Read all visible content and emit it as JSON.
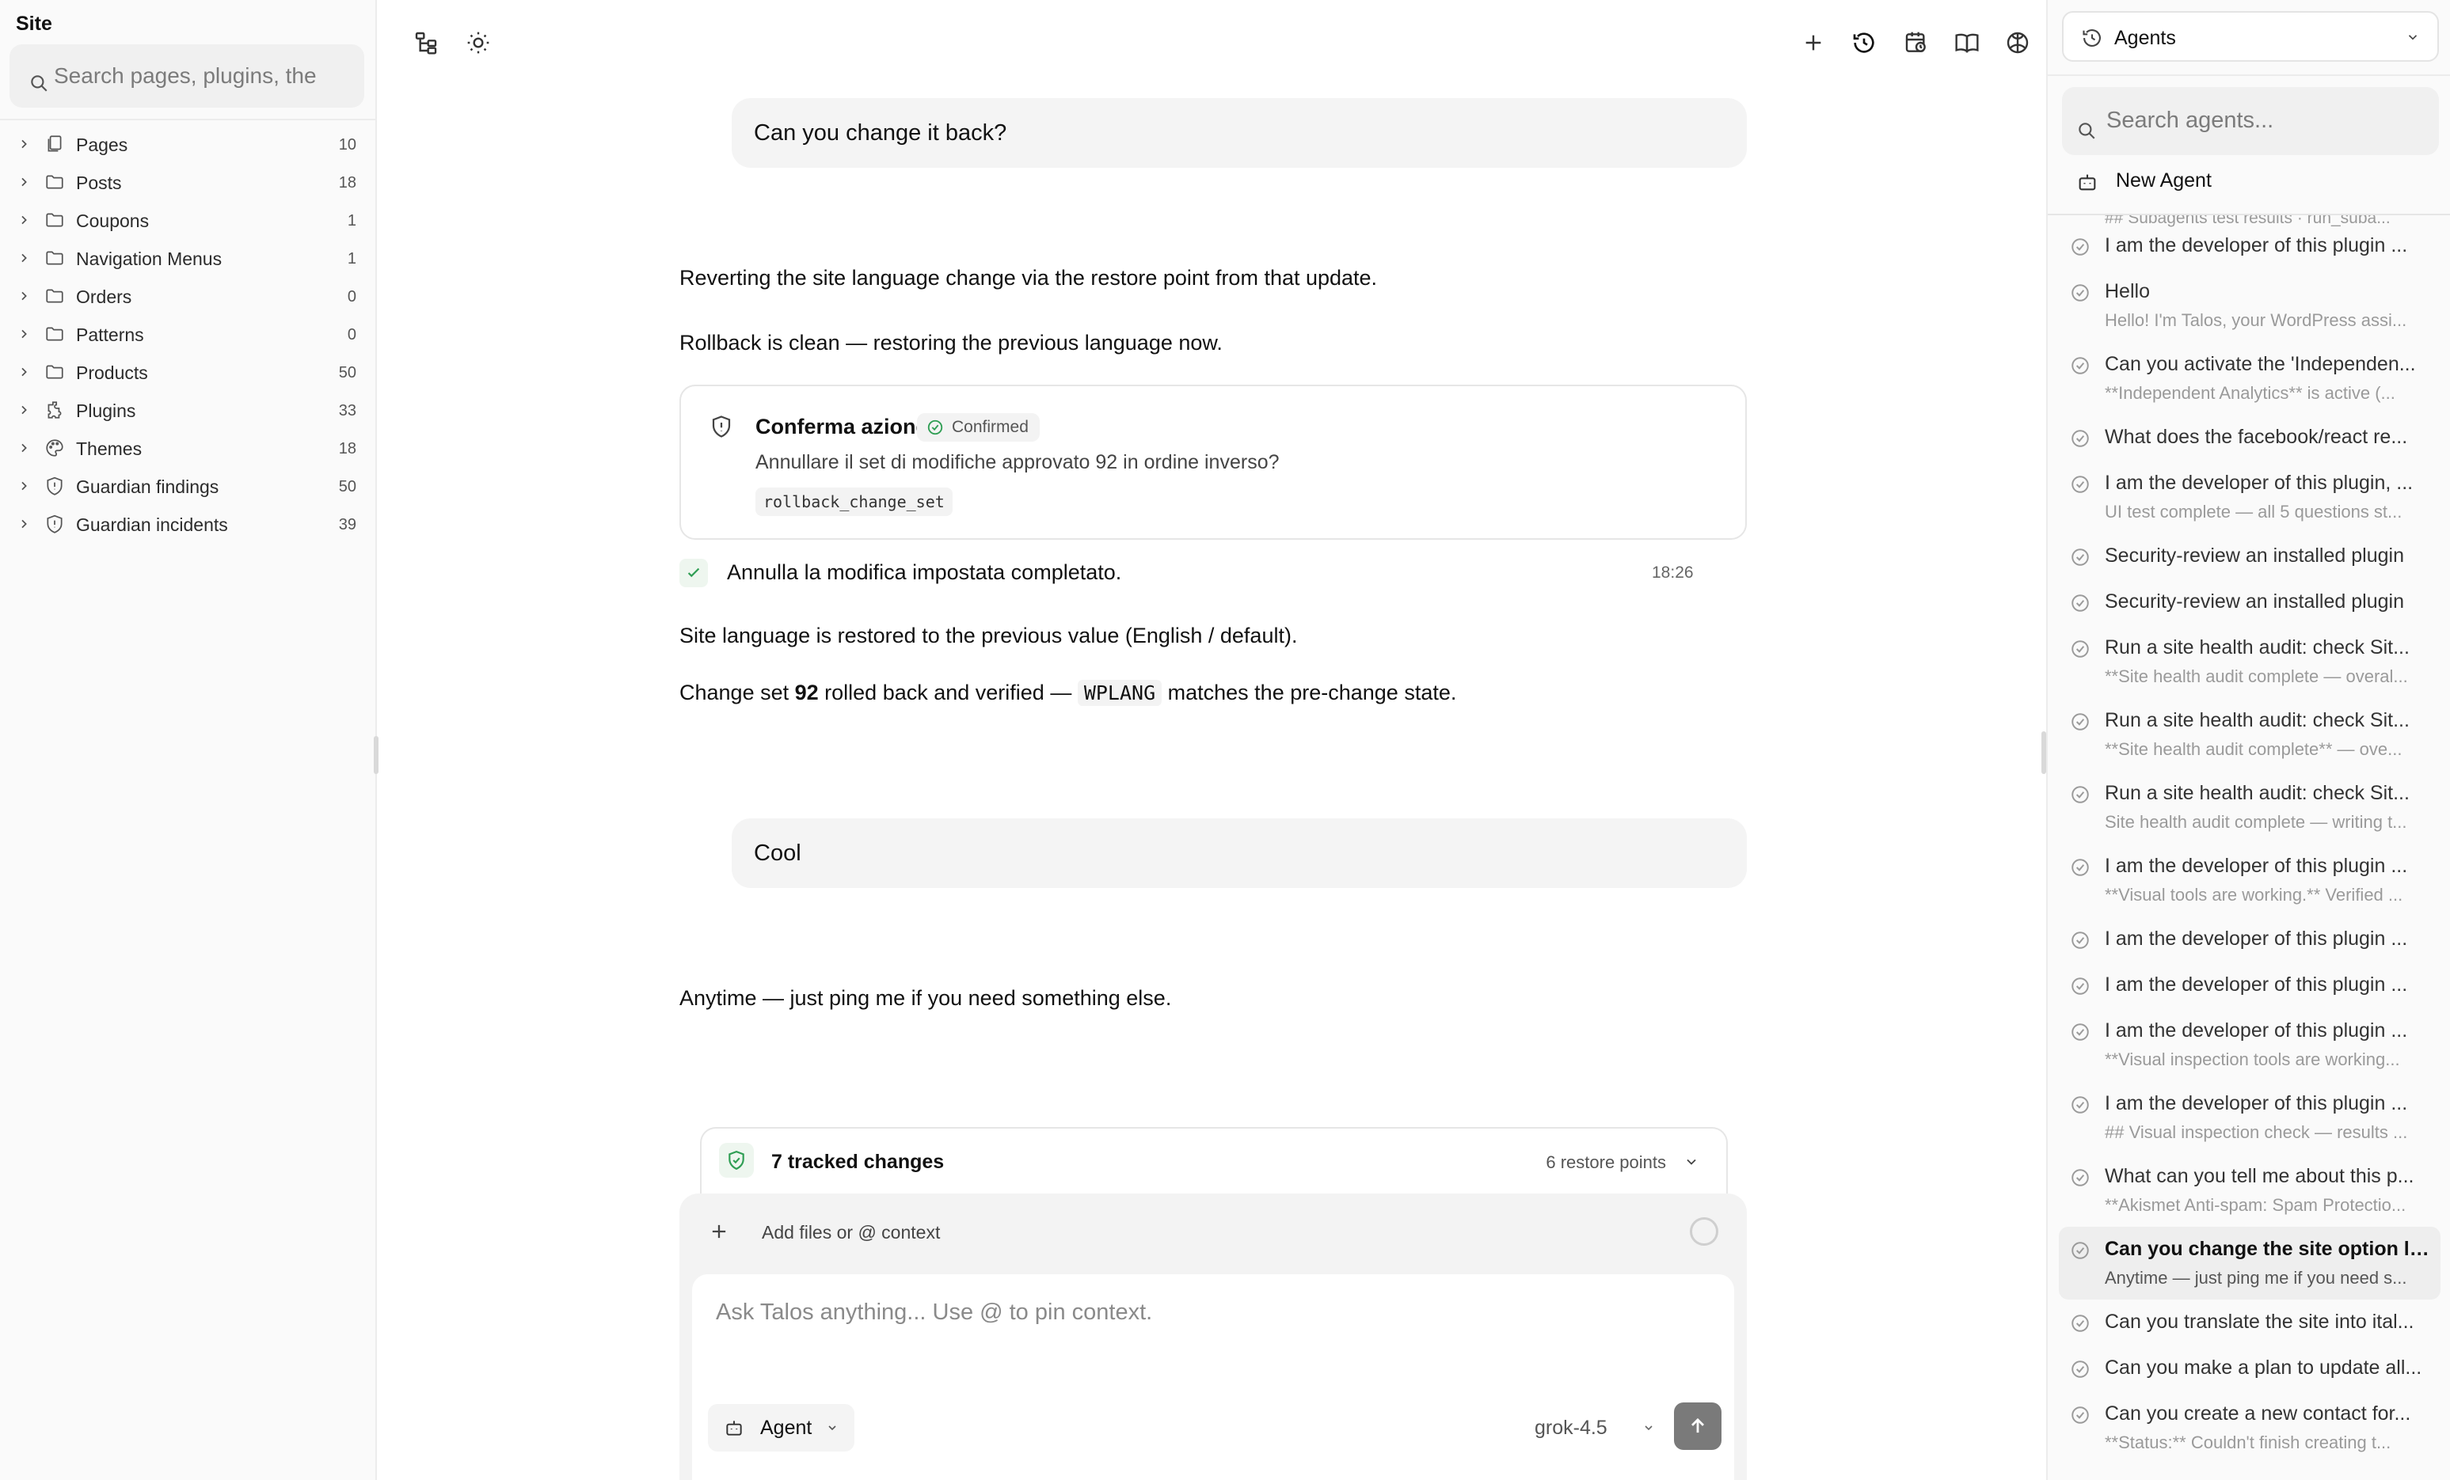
{
  "left_sidebar": {
    "title": "Site",
    "search_placeholder": "Search pages, plugins, the",
    "items": [
      {
        "label": "Pages",
        "count": "10",
        "icon": "pages-icon"
      },
      {
        "label": "Posts",
        "count": "18",
        "icon": "folder-icon"
      },
      {
        "label": "Coupons",
        "count": "1",
        "icon": "folder-icon"
      },
      {
        "label": "Navigation Menus",
        "count": "1",
        "icon": "folder-icon"
      },
      {
        "label": "Orders",
        "count": "0",
        "icon": "folder-icon"
      },
      {
        "label": "Patterns",
        "count": "0",
        "icon": "folder-icon"
      },
      {
        "label": "Products",
        "count": "50",
        "icon": "folder-icon"
      },
      {
        "label": "Plugins",
        "count": "33",
        "icon": "plugin-icon"
      },
      {
        "label": "Themes",
        "count": "18",
        "icon": "palette-icon"
      },
      {
        "label": "Guardian findings",
        "count": "50",
        "icon": "shield-icon"
      },
      {
        "label": "Guardian incidents",
        "count": "39",
        "icon": "shield-icon"
      }
    ]
  },
  "toolbar": {
    "left_icons": [
      "tree-view-icon",
      "sun-icon"
    ],
    "right_icons": [
      "plus-icon",
      "history-icon",
      "schedule-icon",
      "book-icon",
      "brain-icon"
    ]
  },
  "chat": {
    "user_msg_1": "Can you change it back?",
    "assistant_1a": "Reverting the site language change via the restore point from that update.",
    "assistant_1b": "Rollback is clean — restoring the previous language now.",
    "confirm": {
      "title": "Conferma azione",
      "status": "Confirmed",
      "description": "Annullare il set di modifiche approvato 92 in ordine inverso?",
      "tool": "rollback_change_set"
    },
    "tool_result": {
      "text": "Annulla la modifica impostata completato.",
      "time": "18:26"
    },
    "assistant_1c": "Site language is restored to the previous value (English / default).",
    "assistant_1d": {
      "pre": "Change set ",
      "bold": "92",
      "mid": " rolled back and verified — ",
      "code": "WPLANG",
      "post": " matches the pre-change state."
    },
    "user_msg_2": "Cool",
    "assistant_2": "Anytime — just ping me if you need something else."
  },
  "composer": {
    "tracked_label": "7 tracked changes",
    "restore_points": "6 restore points",
    "add_context": "Add files or @ context",
    "placeholder": "Ask Talos anything... Use @ to pin context.",
    "mode": "Agent",
    "model": "grok-4.5"
  },
  "right_sidebar": {
    "dropdown_label": "Agents",
    "search_placeholder": "Search agents...",
    "new_agent": "New Agent",
    "peek_text": "## Subagents test results · run_suba...",
    "agents": [
      {
        "title": "I am the developer of this plugin ...",
        "preview": ""
      },
      {
        "title": "Hello",
        "preview": "Hello! I'm Talos, your WordPress assi..."
      },
      {
        "title": "Can you activate the 'Independen...",
        "preview": "**Independent Analytics** is active (..."
      },
      {
        "title": "What does the facebook/react re...",
        "preview": ""
      },
      {
        "title": "I am the developer of this plugin, ...",
        "preview": "UI test complete — all 5 questions st..."
      },
      {
        "title": "Security-review an installed plugin",
        "preview": ""
      },
      {
        "title": "Security-review an installed plugin",
        "preview": ""
      },
      {
        "title": "Run a site health audit: check Sit...",
        "preview": "**Site health audit complete — overal..."
      },
      {
        "title": "Run a site health audit: check Sit...",
        "preview": "**Site health audit complete** — ove..."
      },
      {
        "title": "Run a site health audit: check Sit...",
        "preview": "Site health audit complete — writing t..."
      },
      {
        "title": "I am the developer of this plugin ...",
        "preview": "**Visual tools are working.** Verified ..."
      },
      {
        "title": "I am the developer of this plugin ...",
        "preview": ""
      },
      {
        "title": "I am the developer of this plugin ...",
        "preview": ""
      },
      {
        "title": "I am the developer of this plugin ...",
        "preview": "**Visual inspection tools are working..."
      },
      {
        "title": "I am the developer of this plugin ...",
        "preview": "## Visual inspection check — results ..."
      },
      {
        "title": "What can you tell me about this p...",
        "preview": "**Akismet Anti-spam: Spam Protectio..."
      },
      {
        "title": "Can you change the site option la...",
        "preview": "Anytime — just ping me if you need s...",
        "active": true
      },
      {
        "title": "Can you translate the site into ital...",
        "preview": ""
      },
      {
        "title": "Can you make a plan to update all...",
        "preview": ""
      },
      {
        "title": "Can you create a new contact for...",
        "preview": "**Status:** Couldn't finish creating t..."
      }
    ]
  }
}
